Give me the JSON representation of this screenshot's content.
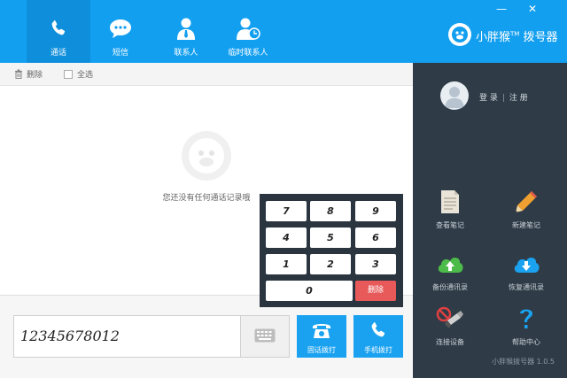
{
  "header": {
    "tabs": [
      {
        "label": "通话",
        "icon": "phone-icon",
        "active": true
      },
      {
        "label": "短信",
        "icon": "chat-icon",
        "active": false
      },
      {
        "label": "联系人",
        "icon": "contact-icon",
        "active": false
      },
      {
        "label": "临时联系人",
        "icon": "temp-contact-icon",
        "active": false
      }
    ],
    "brand": "小胖猴",
    "brand_tm": "TM",
    "brand_suffix": "拨号器",
    "window_controls": {
      "minimize": "—",
      "close": "✕"
    }
  },
  "toolbar": {
    "delete_label": "删除",
    "select_all_label": "全选"
  },
  "main": {
    "empty_text": "您还没有任何通话记录哦"
  },
  "keypad": {
    "rows": [
      [
        "7",
        "8",
        "9"
      ],
      [
        "4",
        "5",
        "6"
      ],
      [
        "1",
        "2",
        "3"
      ]
    ],
    "zero": "0",
    "delete_label": "删除"
  },
  "dialer": {
    "number": "12345678012",
    "landline_label": "固话拨打",
    "mobile_label": "手机拨打"
  },
  "sidebar": {
    "login": "登 录",
    "register": "注 册",
    "items": [
      {
        "label": "查看笔记",
        "icon": "notes-icon"
      },
      {
        "label": "新建笔记",
        "icon": "pencil-icon"
      },
      {
        "label": "备份通讯录",
        "icon": "cloud-upload-icon"
      },
      {
        "label": "恢复通讯录",
        "icon": "cloud-download-icon"
      },
      {
        "label": "连接设备",
        "icon": "usb-disconnected-icon"
      },
      {
        "label": "帮助中心",
        "icon": "help-icon"
      }
    ],
    "version": "小胖猴拨号器 1.0.5"
  },
  "colors": {
    "accent": "#139ff0",
    "sidebar": "#2f3b46",
    "delete": "#e85a5a"
  }
}
